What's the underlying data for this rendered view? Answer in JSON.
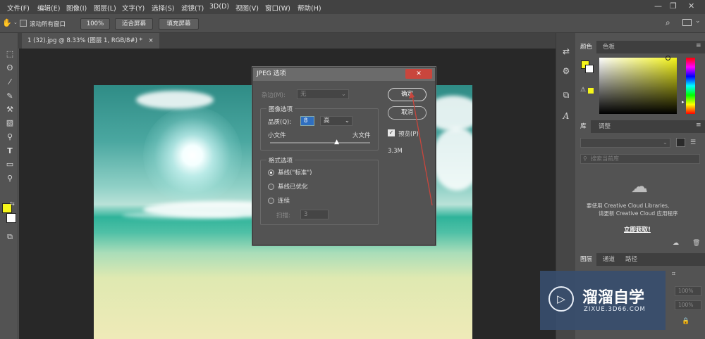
{
  "menu": [
    "文件(F)",
    "编辑(E)",
    "图像(I)",
    "图层(L)",
    "文字(Y)",
    "选择(S)",
    "滤镜(T)",
    "3D(D)",
    "视图(V)",
    "窗口(W)",
    "帮助(H)"
  ],
  "window_controls": {
    "minimize": "—",
    "restore": "❐",
    "close": "✕"
  },
  "options_bar": {
    "scroll_all_label": "滚动所有窗口",
    "zoom_100": "100%",
    "fit_screen": "适合屏幕",
    "fill_screen": "填充屏幕"
  },
  "document_tab": {
    "label": "1 (32).jpg @ 8.33% (图层 1, RGB/8#) *",
    "close": "×"
  },
  "dialog": {
    "title": "JPEG 选项",
    "close": "✕",
    "matte_label": "杂边(M):",
    "matte_value": "无",
    "image_options_legend": "图像选项",
    "quality_label": "品质(Q):",
    "quality_value": "8",
    "quality_level": "高",
    "small_file": "小文件",
    "large_file": "大文件",
    "quality_slider_fraction": 0.67,
    "format_options_legend": "格式选项",
    "formats": [
      {
        "label": "基线(\"标准\")",
        "selected": true
      },
      {
        "label": "基线已优化",
        "selected": false
      },
      {
        "label": "连续",
        "selected": false
      }
    ],
    "scans_label": "扫描:",
    "scans_value": "3",
    "ok_label": "确定",
    "cancel_label": "取消",
    "preview_label": "预览(P)",
    "preview_checked": true,
    "file_size": "3.3M"
  },
  "color_panel": {
    "tabs": [
      "颜色",
      "色板"
    ],
    "foreground": "#f5f51a",
    "background": "#ffffff"
  },
  "library_panel": {
    "tabs": [
      "库",
      "调整"
    ],
    "search_placeholder": "搜索当前库",
    "message_line1": "要使用 Creative Cloud Libraries,",
    "message_line2": "请更新 Creative Cloud 应用程序",
    "link": "立即获取!"
  },
  "layers_panel": {
    "tabs": [
      "图层",
      "通道",
      "路径"
    ],
    "opacity": "100%",
    "fill": "100%"
  },
  "watermark": {
    "brand": "溜溜自学",
    "url": "ZIXUE.3D66.COM"
  },
  "colors": {
    "accent_red": "#c9463d",
    "foreground_yellow": "#f5f51a"
  }
}
